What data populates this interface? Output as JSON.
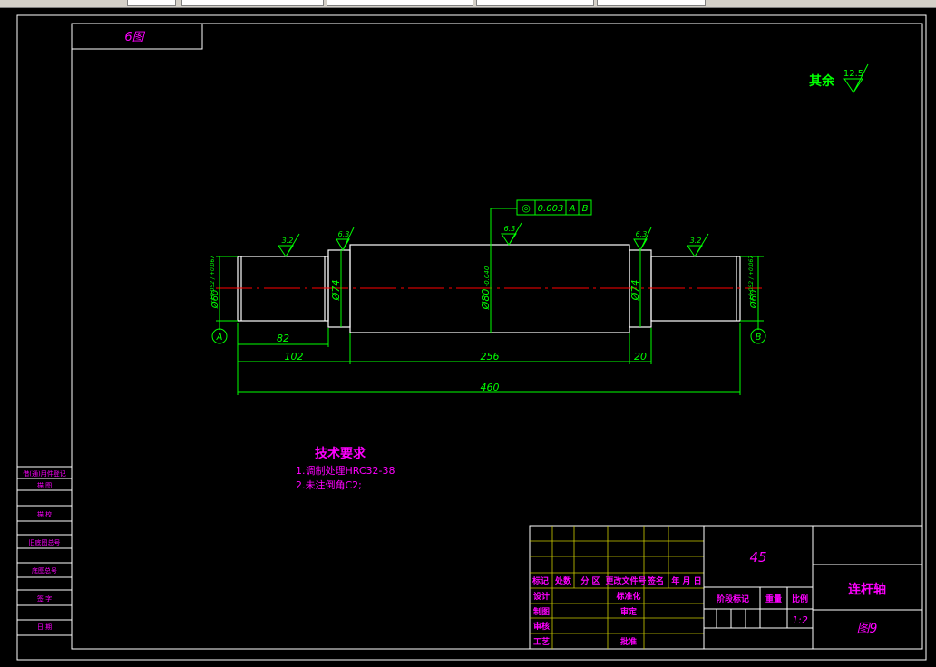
{
  "drawing": {
    "code_box": "6图",
    "surface_note": {
      "label": "其余",
      "value": "12.5"
    },
    "tech_requirements": {
      "title": "技术要求",
      "items": [
        "1.调制处理HRC32-38",
        "2.未注倒角C2;"
      ]
    },
    "roughness_values": [
      "3.2",
      "6.3",
      "6.3",
      "6.3",
      "3.2"
    ],
    "tolerance_frame": {
      "symbol": "◎",
      "value": "0.003",
      "datum1": "A",
      "datum2": "B"
    },
    "dimensions": {
      "d82": "82",
      "d102": "102",
      "d256": "256",
      "d20": "20",
      "d460": "460",
      "dia74_left": "Ø74",
      "dia74_right": "Ø74",
      "dia80": "Ø80",
      "dia80_tol": "-0.040",
      "dia60_left": "Ø60",
      "dia60_left_tol": "+0.052 / +0.067",
      "dia60_right": "Ø60",
      "dia60_right_tol": "+0.052 / +0.067"
    },
    "datum_labels": {
      "left": "A",
      "right": "B"
    }
  },
  "left_strip": {
    "rows": [
      "借(通)用件登记",
      "描 图",
      "描 校",
      "旧底图总号",
      "底图总号",
      "签 字",
      "日 期"
    ]
  },
  "title_block": {
    "material": "45",
    "part_name": "连杆轴",
    "drawing_no": "图9",
    "scale": "1:2",
    "header_row": [
      "标记",
      "处数",
      "分 区",
      "更改文件号",
      "签名",
      "年 月 日"
    ],
    "rows": [
      [
        "设计",
        "标准化"
      ],
      [
        "制图",
        "审定"
      ],
      [
        "审核",
        ""
      ],
      [
        "工艺",
        "批准"
      ]
    ],
    "stage_labels": [
      "阶段标记",
      "重量",
      "比例"
    ]
  }
}
